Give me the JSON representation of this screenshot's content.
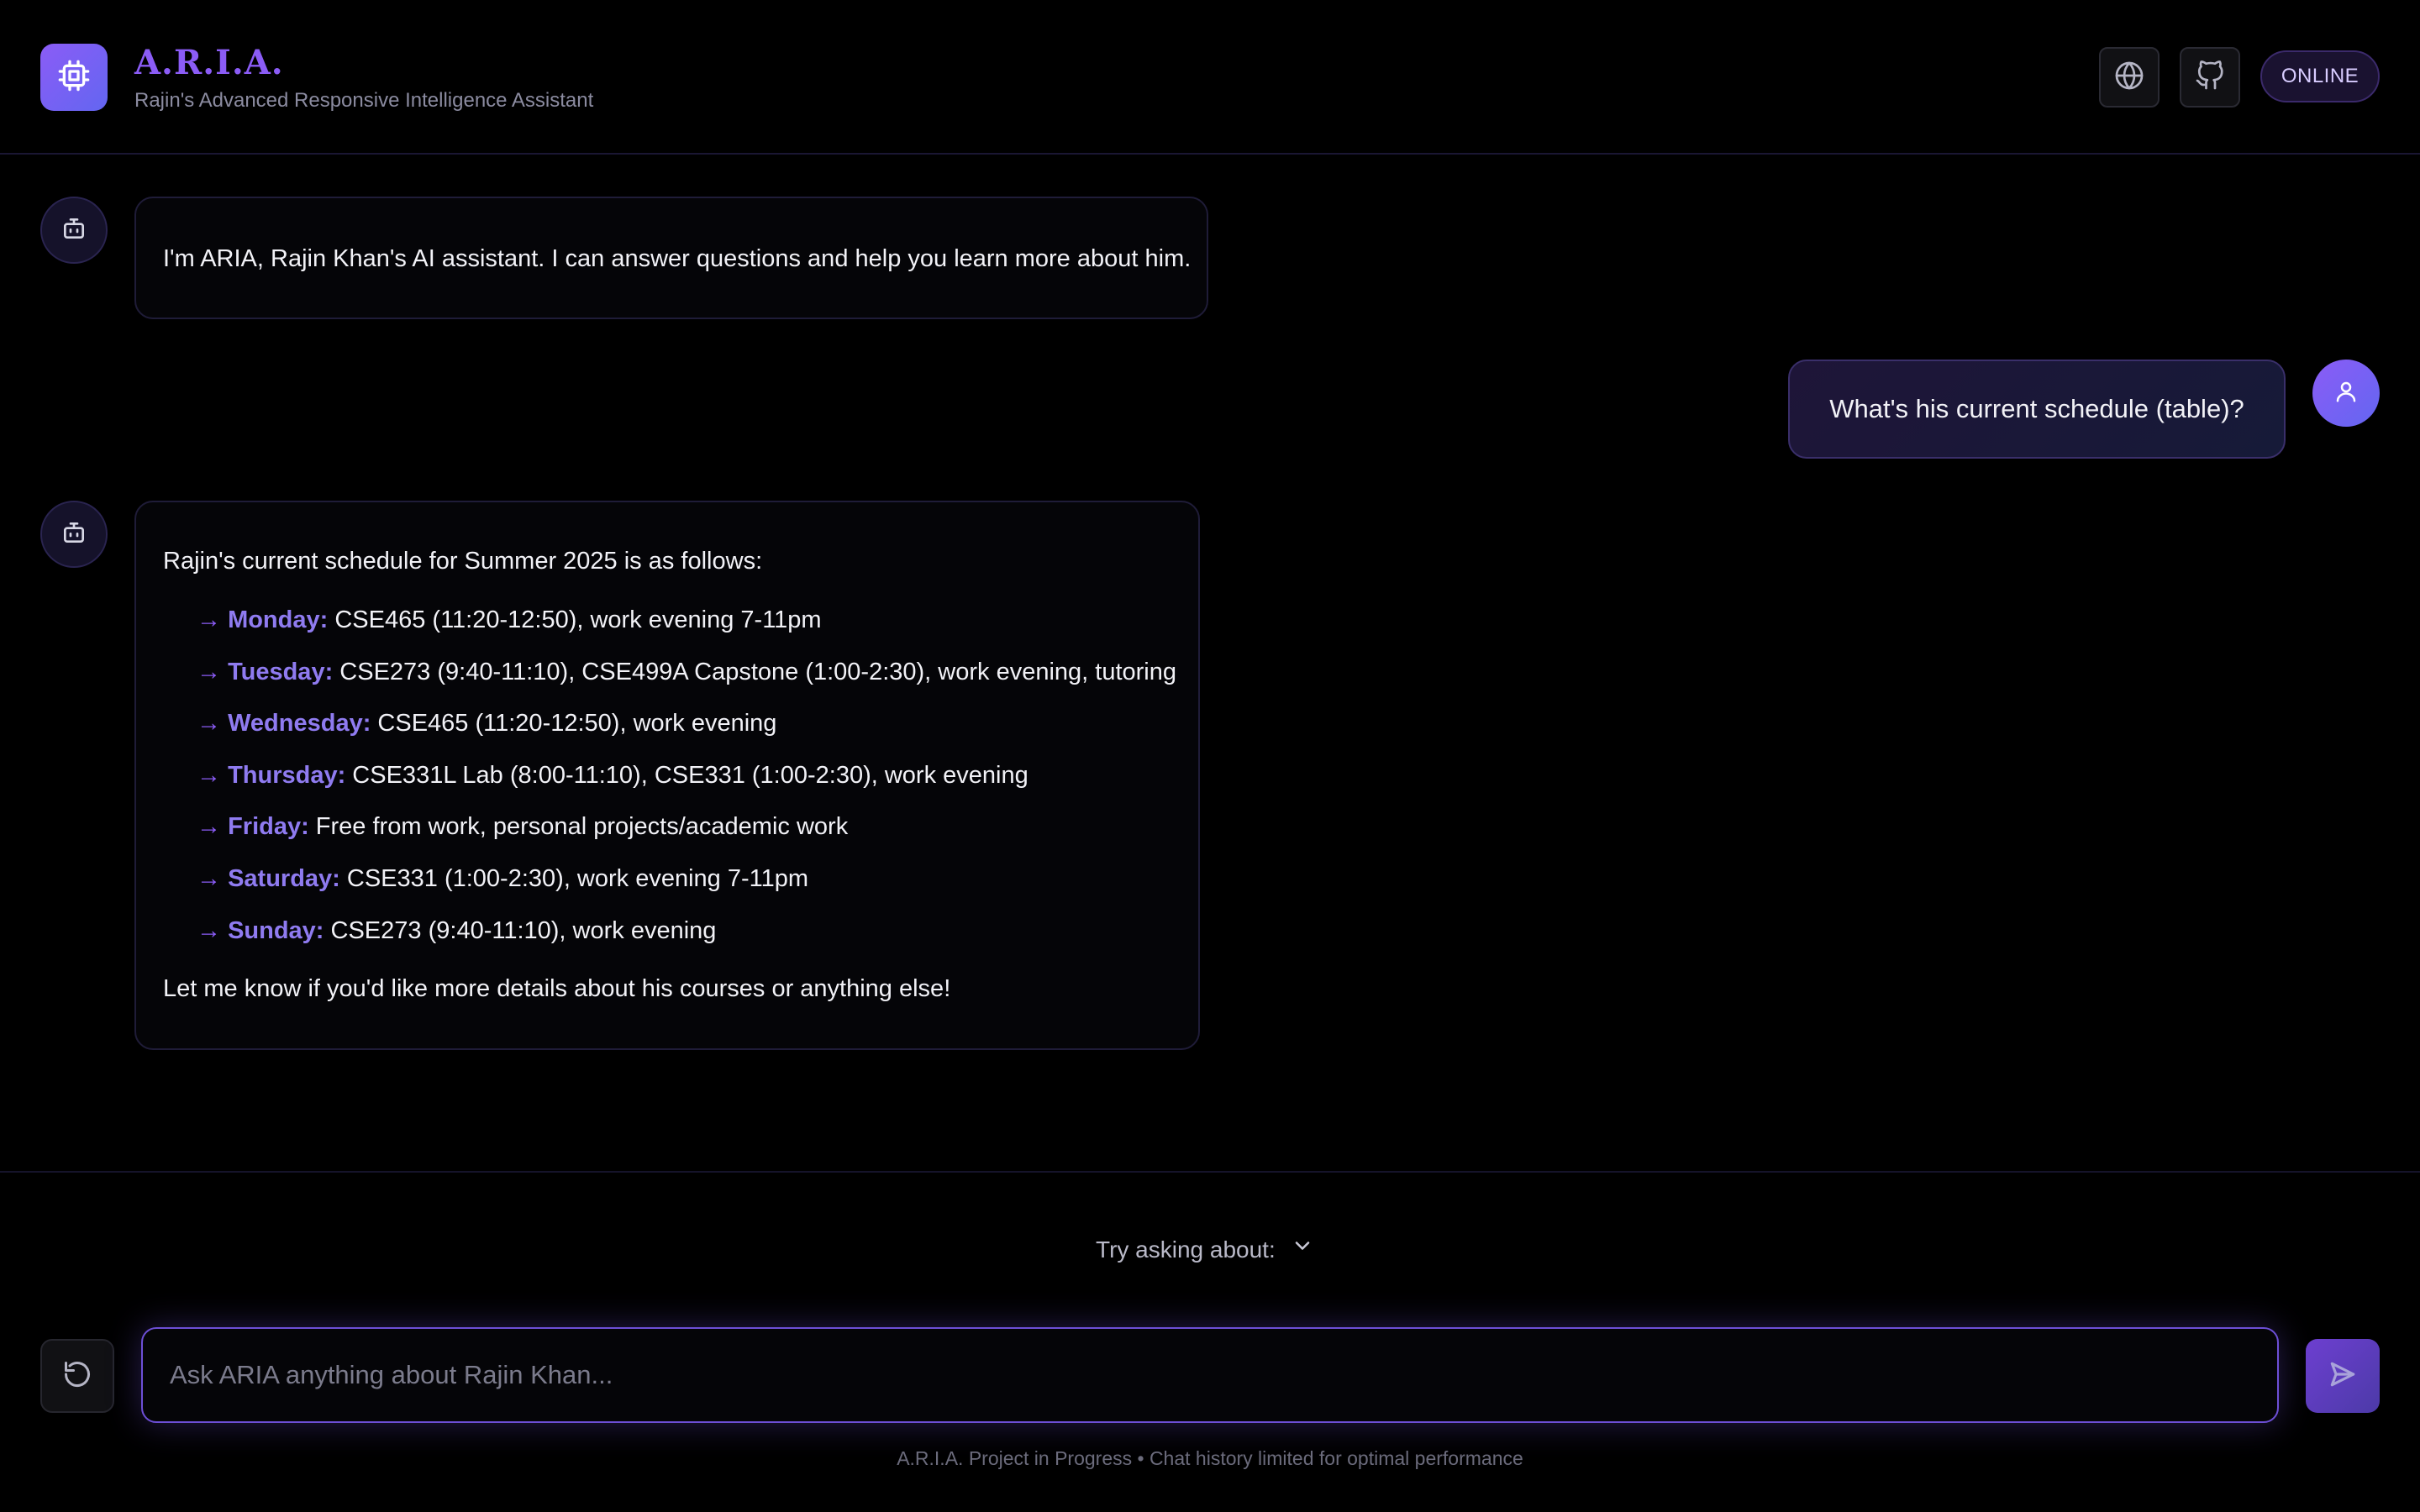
{
  "header": {
    "title": "A.R.I.A.",
    "subtitle": "Rajin's Advanced Responsive Intelligence Assistant",
    "status": "ONLINE",
    "logo_icon": "cpu-chip-icon",
    "language_icon": "globe-icon",
    "github_icon": "github-icon"
  },
  "messages": {
    "intro": "I'm ARIA, Rajin Khan's AI assistant. I can answer questions and help you learn more about him.",
    "user_question": "What's his current schedule (table)?",
    "schedule_intro": "Rajin's current schedule for Summer 2025 is as follows:",
    "schedule": [
      {
        "arrow": "→",
        "day": "Monday:",
        "text": " CSE465 (11:20-12:50), work evening 7-11pm"
      },
      {
        "arrow": "→",
        "day": "Tuesday:",
        "text": " CSE273 (9:40-11:10), CSE499A Capstone (1:00-2:30), work evening, tutoring"
      },
      {
        "arrow": "→",
        "day": "Wednesday:",
        "text": " CSE465 (11:20-12:50), work evening"
      },
      {
        "arrow": "→",
        "day": "Thursday:",
        "text": " CSE331L Lab (8:00-11:10), CSE331 (1:00-2:30), work evening"
      },
      {
        "arrow": "→",
        "day": "Friday:",
        "text": " Free from work, personal projects/academic work"
      },
      {
        "arrow": "→",
        "day": "Saturday:",
        "text": " CSE331 (1:00-2:30), work evening 7-11pm"
      },
      {
        "arrow": "→",
        "day": "Sunday:",
        "text": " CSE273 (9:40-11:10), work evening"
      }
    ],
    "schedule_outro": "Let me know if you'd like more details about his courses or anything else!"
  },
  "composer": {
    "suggestions_label": "Try asking about:",
    "placeholder": "Ask ARIA anything about Rajin Khan...",
    "footer": "A.R.I.A. Project in Progress • Chat history limited for optimal performance"
  },
  "colors": {
    "accent": "#8b5cf6",
    "accent_secondary": "#6366f1",
    "background": "#000000"
  }
}
